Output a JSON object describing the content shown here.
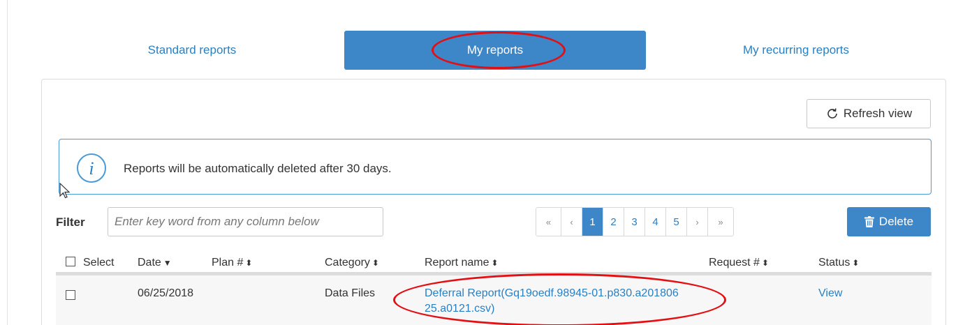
{
  "tabs": {
    "standard": "Standard reports",
    "mine": "My reports",
    "recurring": "My recurring reports"
  },
  "toolbar": {
    "refresh_label": "Refresh view",
    "delete_label": "Delete"
  },
  "info": {
    "message": "Reports will be automatically deleted after 30 days."
  },
  "filter": {
    "label": "Filter",
    "placeholder": "Enter key word from any column below"
  },
  "pagination": {
    "first": "«",
    "prev": "‹",
    "pages": [
      "1",
      "2",
      "3",
      "4",
      "5"
    ],
    "current_page": "1",
    "next": "›",
    "last": "»"
  },
  "table": {
    "headers": {
      "select": "Select",
      "date": "Date",
      "plan": "Plan #",
      "category": "Category",
      "report_name": "Report name",
      "request": "Request #",
      "status": "Status"
    },
    "rows": [
      {
        "date": "06/25/2018",
        "plan": "",
        "category": "Data Files",
        "report_name_line1": "Deferral Report(Gq19oedf.98945-01.p830.a201806",
        "report_name_line2": "25.a0121.csv)",
        "request": "",
        "status": "View"
      }
    ]
  },
  "colors": {
    "accent": "#3d86c8",
    "link": "#2a7fc1",
    "annotation": "#e30f13",
    "info_border": "#4b9ad8"
  },
  "icons": {
    "refresh": "refresh-icon",
    "info": "info-icon",
    "delete": "trash-icon",
    "cursor": "mouse-pointer-icon"
  }
}
